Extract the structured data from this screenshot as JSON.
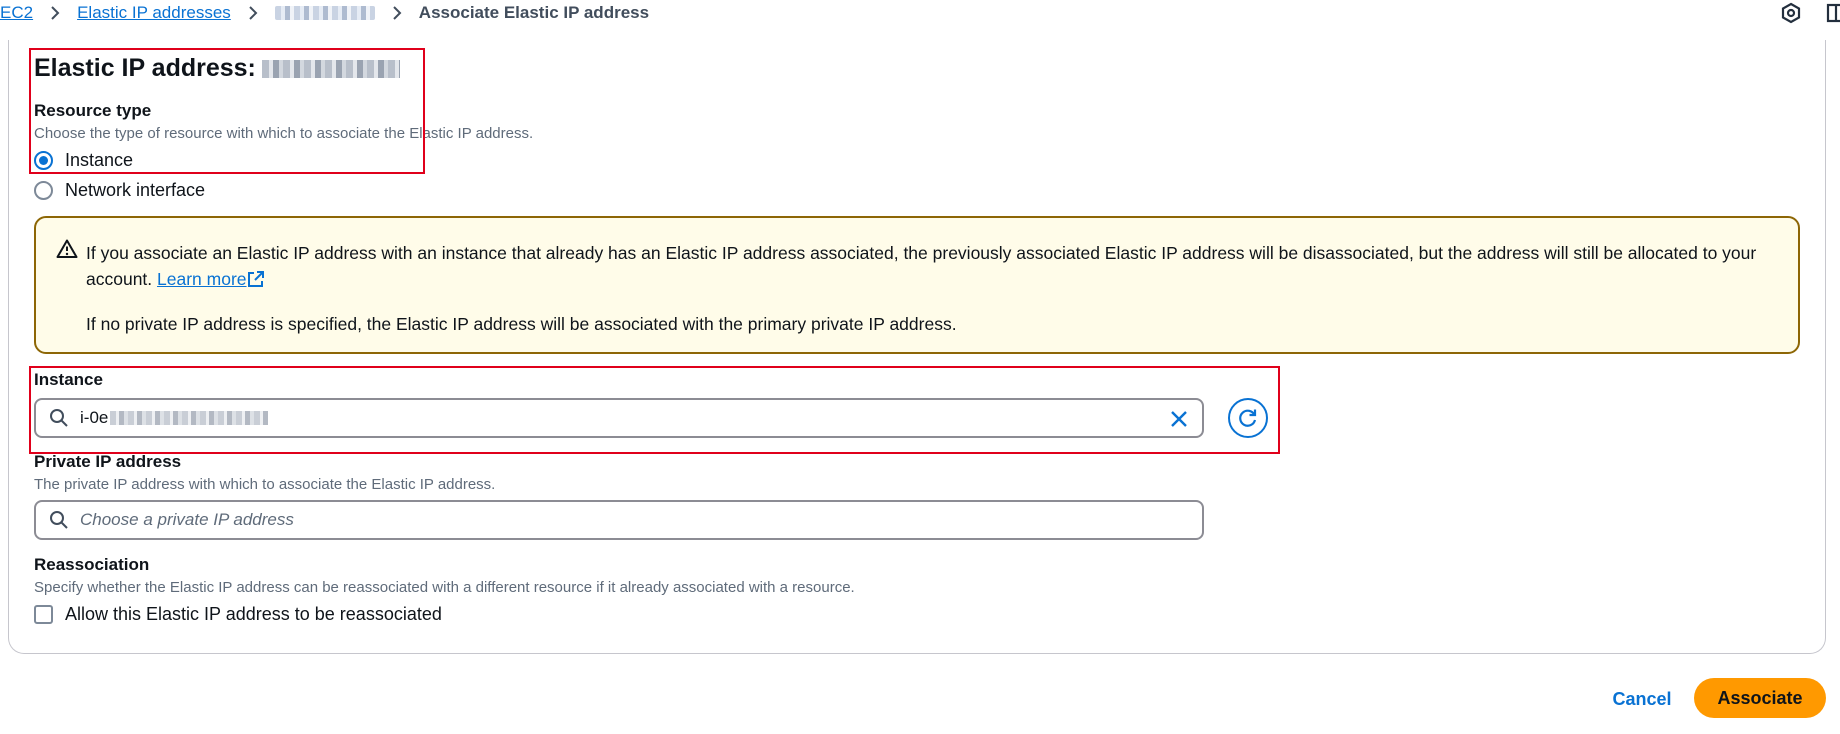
{
  "breadcrumb": {
    "items": [
      "EC2",
      "Elastic IP addresses"
    ],
    "current": "Associate Elastic IP address"
  },
  "header": {
    "title": "Elastic IP address:"
  },
  "resource_type": {
    "label": "Resource type",
    "description": "Choose the type of resource with which to associate the Elastic IP address.",
    "options": [
      "Instance",
      "Network interface"
    ],
    "selected": "Instance"
  },
  "alert": {
    "line1": "If you associate an Elastic IP address with an instance that already has an Elastic IP address associated, the previously associated Elastic IP address will be disassociated, but the address will still be allocated to your account.",
    "link": "Learn more",
    "line2": "If no private IP address is specified, the Elastic IP address will be associated with the primary private IP address."
  },
  "instance": {
    "label": "Instance",
    "value_prefix": "i-0e"
  },
  "private_ip": {
    "label": "Private IP address",
    "description": "The private IP address with which to associate the Elastic IP address.",
    "placeholder": "Choose a private IP address"
  },
  "reassociation": {
    "label": "Reassociation",
    "description": "Specify whether the Elastic IP address can be reassociated with a different resource if it already associated with a resource.",
    "checkbox_label": "Allow this Elastic IP address to be reassociated",
    "checked": false
  },
  "footer": {
    "cancel": "Cancel",
    "submit": "Associate"
  },
  "colors": {
    "link": "#0972d3",
    "primary_button": "#ff9900",
    "alert_bg": "#fffce9",
    "alert_border": "#8d6605",
    "highlight": "#e0001b"
  },
  "icons": [
    "chevron-right-icon",
    "settings-icon",
    "external-link-icon",
    "warning-icon",
    "search-icon",
    "close-icon",
    "refresh-icon"
  ]
}
